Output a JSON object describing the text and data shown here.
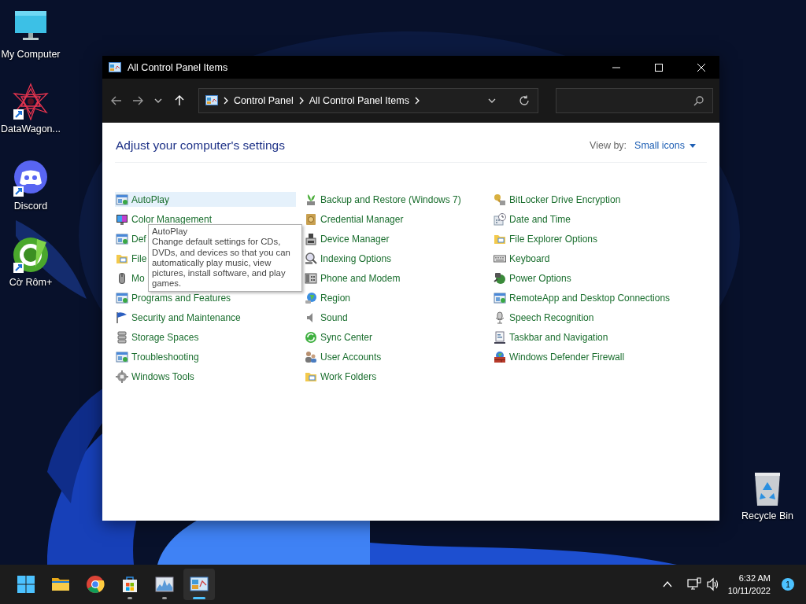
{
  "desktop_icons": [
    {
      "label": "My Computer",
      "kind": "monitor",
      "shortcut": false
    },
    {
      "label": "DataWagon...",
      "kind": "star",
      "shortcut": true
    },
    {
      "label": "Discord",
      "kind": "controller",
      "shortcut": true
    },
    {
      "label": "Cờ Rôm+",
      "kind": "ring",
      "shortcut": true
    },
    {
      "label": "Recycle Bin",
      "kind": "bin",
      "shortcut": false
    }
  ],
  "window": {
    "title": "All Control Panel Items",
    "address": [
      "Control Panel",
      "All Control Panel Items"
    ],
    "heading": "Adjust your computer's settings",
    "view_by_label": "View by:",
    "view_by_value": "Small icons",
    "columns": [
      {
        "items": [
          {
            "label": "AutoPlay",
            "kind": "window",
            "hovered": true
          },
          {
            "label": "Color Management",
            "kind": "monitor",
            "hovered": false
          },
          {
            "label": "Def",
            "kind": "window",
            "hovered": false
          },
          {
            "label": "File",
            "kind": "folder",
            "hovered": false
          },
          {
            "label": "Mo",
            "kind": "mouse",
            "hovered": false
          },
          {
            "label": "Programs and Features",
            "kind": "window",
            "hovered": false
          },
          {
            "label": "Security and Maintenance",
            "kind": "flag",
            "hovered": false
          },
          {
            "label": "Storage Spaces",
            "kind": "drives",
            "hovered": false
          },
          {
            "label": "Troubleshooting",
            "kind": "window",
            "hovered": false
          },
          {
            "label": "Windows Tools",
            "kind": "gear",
            "hovered": false
          }
        ]
      },
      {
        "items": [
          {
            "label": "Backup and Restore (Windows 7)",
            "kind": "plant",
            "hovered": false
          },
          {
            "label": "Credential Manager",
            "kind": "safe",
            "hovered": false
          },
          {
            "label": "Device Manager",
            "kind": "device",
            "hovered": false
          },
          {
            "label": "Indexing Options",
            "kind": "magnifier",
            "hovered": false
          },
          {
            "label": "Phone and Modem",
            "kind": "phone",
            "hovered": false
          },
          {
            "label": "Region",
            "kind": "globe",
            "hovered": false
          },
          {
            "label": "Sound",
            "kind": "speaker",
            "hovered": false
          },
          {
            "label": "Sync Center",
            "kind": "sync",
            "hovered": false
          },
          {
            "label": "User Accounts",
            "kind": "people",
            "hovered": false
          },
          {
            "label": "Work Folders",
            "kind": "folder",
            "hovered": false
          }
        ]
      },
      {
        "items": [
          {
            "label": "BitLocker Drive Encryption",
            "kind": "key",
            "hovered": false
          },
          {
            "label": "Date and Time",
            "kind": "calendar",
            "hovered": false
          },
          {
            "label": "File Explorer Options",
            "kind": "folder",
            "hovered": false
          },
          {
            "label": "Keyboard",
            "kind": "keyboard",
            "hovered": false
          },
          {
            "label": "Power Options",
            "kind": "power",
            "hovered": false
          },
          {
            "label": "RemoteApp and Desktop Connections",
            "kind": "window",
            "hovered": false
          },
          {
            "label": "Speech Recognition",
            "kind": "microphone",
            "hovered": false
          },
          {
            "label": "Taskbar and Navigation",
            "kind": "document",
            "hovered": false
          },
          {
            "label": "Windows Defender Firewall",
            "kind": "wall",
            "hovered": false
          }
        ]
      }
    ],
    "tooltip": {
      "title": "AutoPlay",
      "text": "Change default settings for CDs, DVDs, and devices so that you can automatically play music, view pictures, install software, and play games."
    }
  },
  "taskbar": {
    "apps": [
      {
        "kind": "start",
        "running": false,
        "active": false
      },
      {
        "kind": "folder",
        "running": false,
        "active": false
      },
      {
        "kind": "browser",
        "running": false,
        "active": false
      },
      {
        "kind": "store",
        "running": true,
        "active": false
      },
      {
        "kind": "chart",
        "running": true,
        "active": false
      },
      {
        "kind": "panel",
        "running": true,
        "active": true
      }
    ],
    "clock": {
      "time": "6:32 AM",
      "date": "10/11/2022"
    },
    "notifications": "1"
  }
}
